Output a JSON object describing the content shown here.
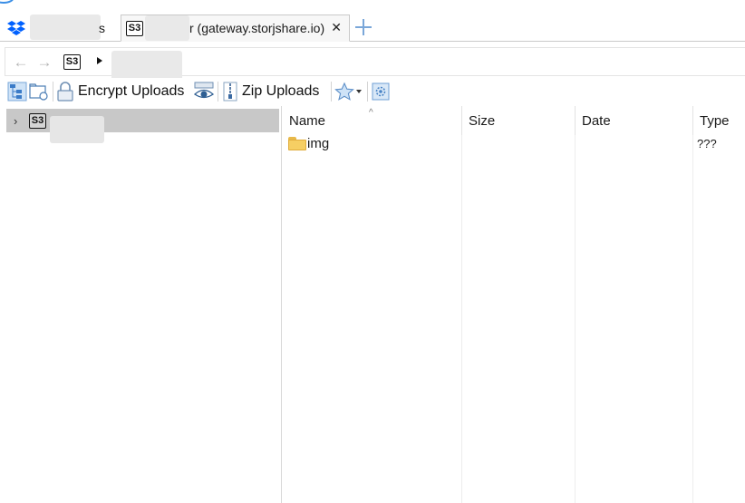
{
  "tabs": [
    {
      "label_suffix": "s"
    },
    {
      "badge": "S3",
      "label_suffix": "r (gateway.storjshare.io)",
      "close": "✕"
    }
  ],
  "nav": {
    "back": "←",
    "forward": "→",
    "badge": "S3"
  },
  "toolbar": {
    "encrypt_uploads": "Encrypt Uploads",
    "zip_uploads": "Zip Uploads"
  },
  "tree": {
    "chevron": "›",
    "badge": "S3"
  },
  "columns": {
    "name": "Name",
    "size": "Size",
    "date": "Date",
    "type": "Type",
    "sort_indicator": "^"
  },
  "files": [
    {
      "name": "img",
      "size": "",
      "date": "",
      "type": "???"
    }
  ],
  "colors": {
    "accent": "#3a8ee6",
    "selection": "#c8c8c8",
    "folder": "#f6cf63"
  }
}
